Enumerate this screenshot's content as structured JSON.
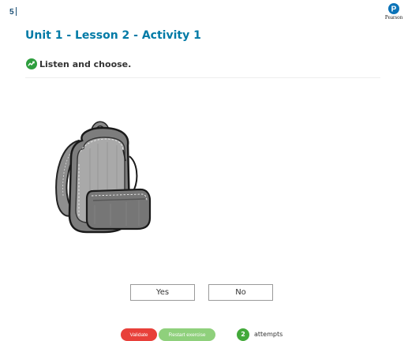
{
  "header": {
    "page_number": "5",
    "logo_text": "Pearson",
    "title": "Unit 1 - Lesson 2 - Activity 1"
  },
  "activity": {
    "instruction": "Listen and choose.",
    "image_icon": "backpack-icon",
    "options": [
      {
        "label": "Yes"
      },
      {
        "label": "No"
      }
    ]
  },
  "footer": {
    "validate_label": "Validate",
    "restart_label": "Restart exercise",
    "attempts_count": "2",
    "attempts_label": "attempts"
  },
  "colors": {
    "title": "#007aa6",
    "instruction_icon": "#2e9e3e",
    "validate": "#e8403a",
    "restart": "#8fd07c",
    "attempts_badge": "#43a93a"
  }
}
